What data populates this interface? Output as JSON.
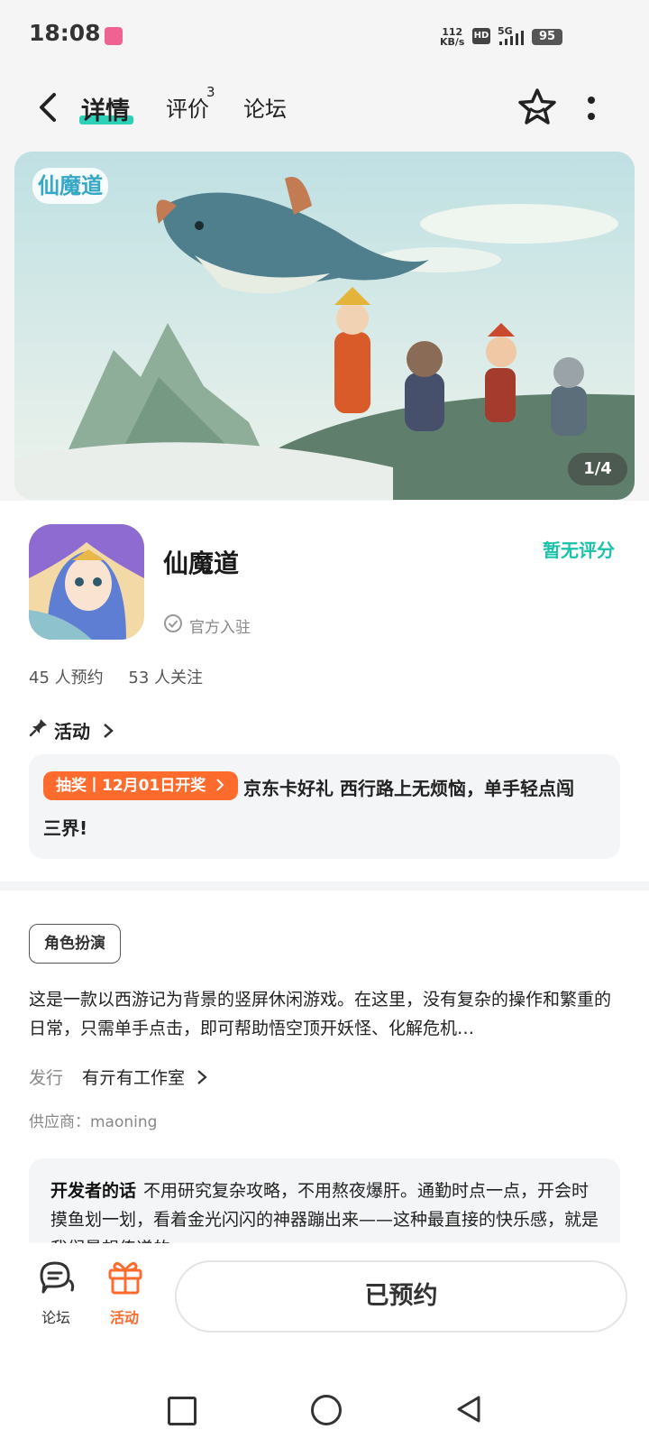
{
  "status_bar": {
    "time": "18:08",
    "net_speed_top": "112",
    "net_speed_bottom": "KB/s",
    "hd": "HD",
    "network": "5G",
    "battery": "95"
  },
  "header": {
    "tabs": [
      {
        "label": "详情",
        "active": true
      },
      {
        "label": "评价",
        "badge": "3"
      },
      {
        "label": "论坛"
      }
    ],
    "accent_color": "#2ed1b8"
  },
  "banner": {
    "counter": "1/4",
    "logo_text": "仙魔道"
  },
  "game": {
    "title": "仙魔道",
    "official": "官方入驻",
    "rating": "暂无评分",
    "reservations": "45 人预约",
    "follows": "53 人关注"
  },
  "activity": {
    "section_label": "活动",
    "tag": "抽奖丨12月01日开奖",
    "line1": "京东卡好礼 西行路上无烦恼，单手轻点闯",
    "line2": "三界!"
  },
  "details": {
    "genre": "角色扮演",
    "description": "这是一款以西游记为背景的竖屏休闲游戏。在这里，没有复杂的操作和繁重的日常，只需单手点击，即可帮助悟空顶开妖怪、化解危机…",
    "publisher_label": "发行",
    "publisher": "有亓有工作室",
    "supplier": "供应商：maoning"
  },
  "developer": {
    "label": "开发者的话",
    "text": "不用研究复杂攻略，不用熬夜爆肝。通勤时点一点，开会时摸鱼划一划，看着金光闪闪的神器蹦出来——这种最直接的快乐感，就是我们最想传递的。"
  },
  "bottom_bar": {
    "forum_label": "论坛",
    "activity_label": "活动",
    "reserve_label": "已预约",
    "activity_color": "#ff6b2c"
  }
}
